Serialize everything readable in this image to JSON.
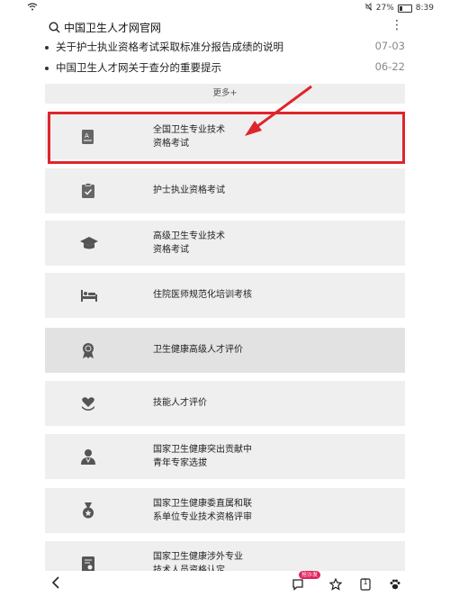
{
  "status": {
    "battery": "27%",
    "time": "8:39"
  },
  "header": {
    "title": "中国卫生人才网官网",
    "more_label": "⋮"
  },
  "news": [
    {
      "text": "关于护士执业资格考试采取标准分报告成绩的说明",
      "date": "07-03"
    },
    {
      "text": "中国卫生人才网关于查分的重要提示",
      "date": "06-22"
    }
  ],
  "more_button": "更多+",
  "cards": [
    {
      "line1": "全国卫生专业技术",
      "line2": "资格考试",
      "icon": "exam-book-icon"
    },
    {
      "line1": "护士执业资格考试",
      "line2": "",
      "icon": "clipboard-icon"
    },
    {
      "line1": "高级卫生专业技术",
      "line2": "资格考试",
      "icon": "graduation-cap-icon"
    },
    {
      "line1": "住院医师规范化培训考核",
      "line2": "",
      "icon": "hospital-bed-icon"
    },
    {
      "line1": "卫生健康高级人才评价",
      "line2": "",
      "icon": "award-badge-icon"
    },
    {
      "line1": "技能人才评价",
      "line2": "",
      "icon": "heart-hand-icon"
    },
    {
      "line1": "国家卫生健康突出贡献中",
      "line2": "青年专家选拔",
      "icon": "doctor-icon"
    },
    {
      "line1": "国家卫生健康委直属和联",
      "line2": "系单位专业技术资格评审",
      "icon": "medal-icon"
    },
    {
      "line1": "国家卫生健康涉外专业",
      "line2": "技术人员资格认定",
      "icon": "certificate-icon"
    }
  ],
  "bottom": {
    "badge": "抢沙发",
    "page": "1"
  },
  "colors": {
    "highlight": "#e0242c",
    "card_bg": "#efefef",
    "card_bg_dark": "#e2e2e2"
  }
}
